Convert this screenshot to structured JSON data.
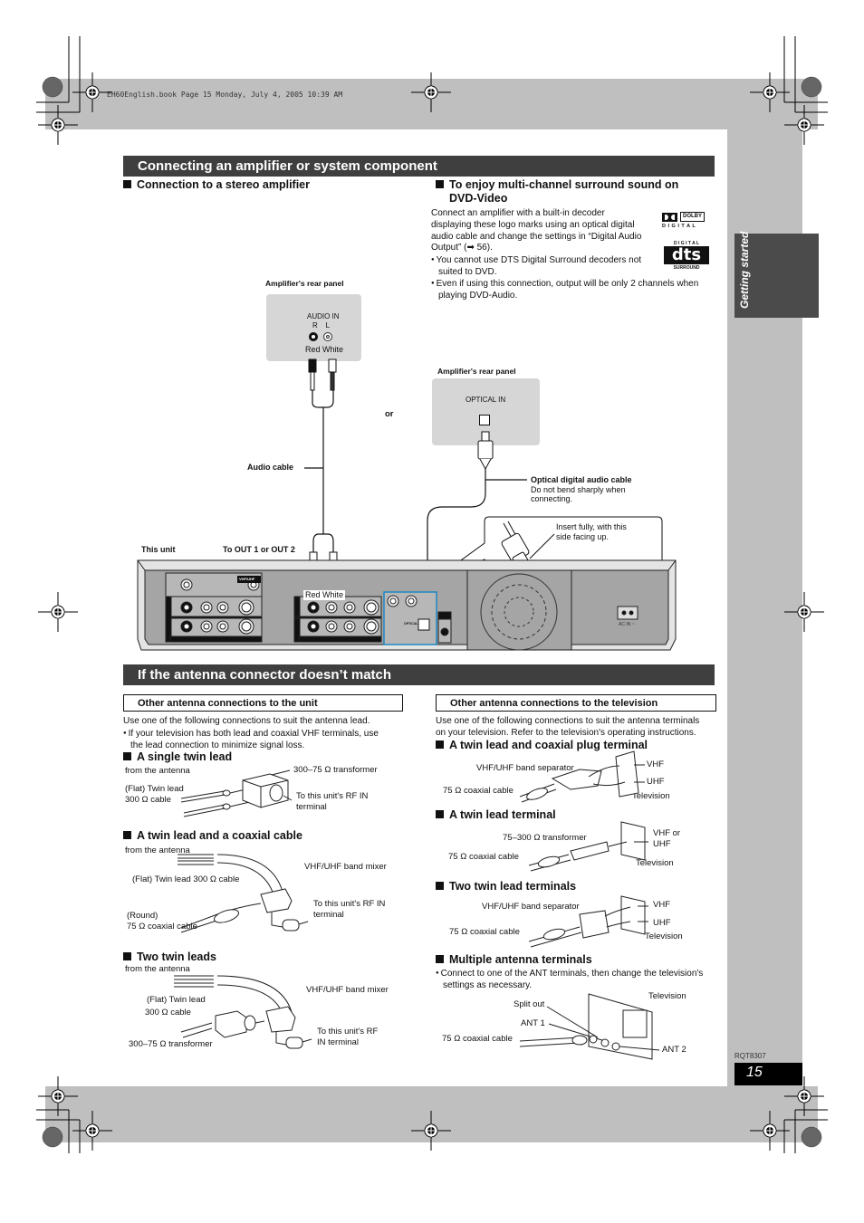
{
  "print_header": "EH60English.book  Page 15  Monday, July 4, 2005  10:39 AM",
  "side_tab": "Getting started",
  "doc_code": "RQT8307",
  "page_number": "15",
  "section1": {
    "title": "Connecting an amplifier or system component",
    "left": {
      "heading": "Connection to a stereo amplifier",
      "amp_panel_label": "Amplifier's rear panel",
      "audio_in": "AUDIO IN",
      "r": "R",
      "l": "L",
      "red_white": "Red White",
      "audio_cable": "Audio cable",
      "or": "or",
      "this_unit": "This unit",
      "to_out": "To OUT 1 or OUT 2",
      "unit_red_white": "Red White"
    },
    "right": {
      "heading_line1": "To enjoy multi-channel surround sound on",
      "heading_line2": "DVD-Video",
      "paragraph": [
        "Connect an amplifier with a built-in decoder",
        "displaying these logo marks using an optical digital",
        "audio cable and change the settings in “Digital Audio",
        "Output” (➡ 56)."
      ],
      "bullets": [
        [
          "You cannot use DTS Digital Surround decoders not",
          "suited to DVD."
        ],
        [
          "Even if using this connection, output will be only 2 channels when",
          "playing DVD-Audio."
        ]
      ],
      "dolby_logo": "DOLBY",
      "dolby_sub": "D I G I T A L",
      "dts_top": "D I G I T A L",
      "dts_logo": "dts",
      "dts_bottom": "SURROUND",
      "amp_panel_label": "Amplifier's rear panel",
      "optical_in": "OPTICAL IN",
      "optical_cable_title": "Optical digital audio cable",
      "optical_cable_note": [
        "Do not bend sharply when",
        "connecting."
      ],
      "insert_note": [
        "Insert fully, with this",
        "side facing up."
      ]
    },
    "unit_labels": {
      "vhf_uhf": "VHF/UHF",
      "rf_out": "RF OUT",
      "rf_in": "RF IN",
      "in1": "IN1",
      "in2": "IN2",
      "out1": "OUT1",
      "out2": "OUT2",
      "raudio_l": "R-AUDIO-L",
      "video": "VIDEO",
      "svideo": "S VIDEO",
      "y": "Y",
      "pb": "PB",
      "pr": "PR",
      "optical": "OPTICAL",
      "component": "COMPONENT VIDEO OUT",
      "digital_audio_out": "DIGITAL AUDIO OUT (PCM/BITSTREAM)",
      "ac_in": "AC IN ~"
    }
  },
  "section2": {
    "title": "If the antenna connector doesn’t match",
    "left": {
      "box_heading": "Other antenna connections to the unit",
      "intro": "Use one of the following connections to suit the antenna lead.",
      "bullet": [
        "If your television has both lead and coaxial VHF terminals, use",
        "the lead connection to minimize signal loss."
      ],
      "items": [
        {
          "heading": "A single twin lead",
          "labels": {
            "from": "from the antenna",
            "transformer": "300–75 Ω transformer",
            "twin": [
              "(Flat) Twin lead",
              "300 Ω cable"
            ],
            "to": [
              "To this unit's RF IN",
              "terminal"
            ]
          }
        },
        {
          "heading": "A twin lead and a coaxial cable",
          "labels": {
            "from": "from the antenna",
            "twin": "(Flat) Twin lead 300 Ω cable",
            "mixer": "VHF/UHF band mixer",
            "to": [
              "To this unit's RF IN",
              "terminal"
            ],
            "coax": [
              "(Round)",
              "75 Ω coaxial cable"
            ]
          }
        },
        {
          "heading": "Two twin leads",
          "labels": {
            "from": "from the antenna",
            "twin": [
              "(Flat) Twin lead",
              "300 Ω cable"
            ],
            "mixer": "VHF/UHF band mixer",
            "transformer": "300–75 Ω transformer",
            "to": [
              "To this unit's RF",
              "IN terminal"
            ]
          }
        }
      ]
    },
    "right": {
      "box_heading": "Other antenna connections to the television",
      "intro": [
        "Use one of the following connections to suit the antenna terminals",
        "on your television. Refer to the television's operating instructions."
      ],
      "items": [
        {
          "heading": "A twin lead and coaxial plug terminal",
          "labels": {
            "separator": "VHF/UHF band separator",
            "vhf": "VHF",
            "uhf": "UHF",
            "coax": "75 Ω coaxial cable",
            "tv": "Television"
          }
        },
        {
          "heading": "A twin lead terminal",
          "labels": {
            "transformer": "75–300 Ω transformer",
            "vhf_or": "VHF or",
            "uhf": "UHF",
            "coax": "75 Ω coaxial cable",
            "tv": "Television"
          }
        },
        {
          "heading": "Two twin lead terminals",
          "labels": {
            "separator": "VHF/UHF band separator",
            "vhf": "VHF",
            "uhf": "UHF",
            "coax": "75 Ω coaxial cable",
            "tv": "Television"
          }
        },
        {
          "heading": "Multiple antenna terminals",
          "bullet": [
            "Connect to one of the ANT terminals, then change the television's",
            "settings as necessary."
          ],
          "labels": {
            "tv": "Television",
            "split": "Split out",
            "ant1": "ANT 1",
            "coax": "75 Ω coaxial cable",
            "ant2": "ANT 2"
          }
        }
      ]
    }
  }
}
